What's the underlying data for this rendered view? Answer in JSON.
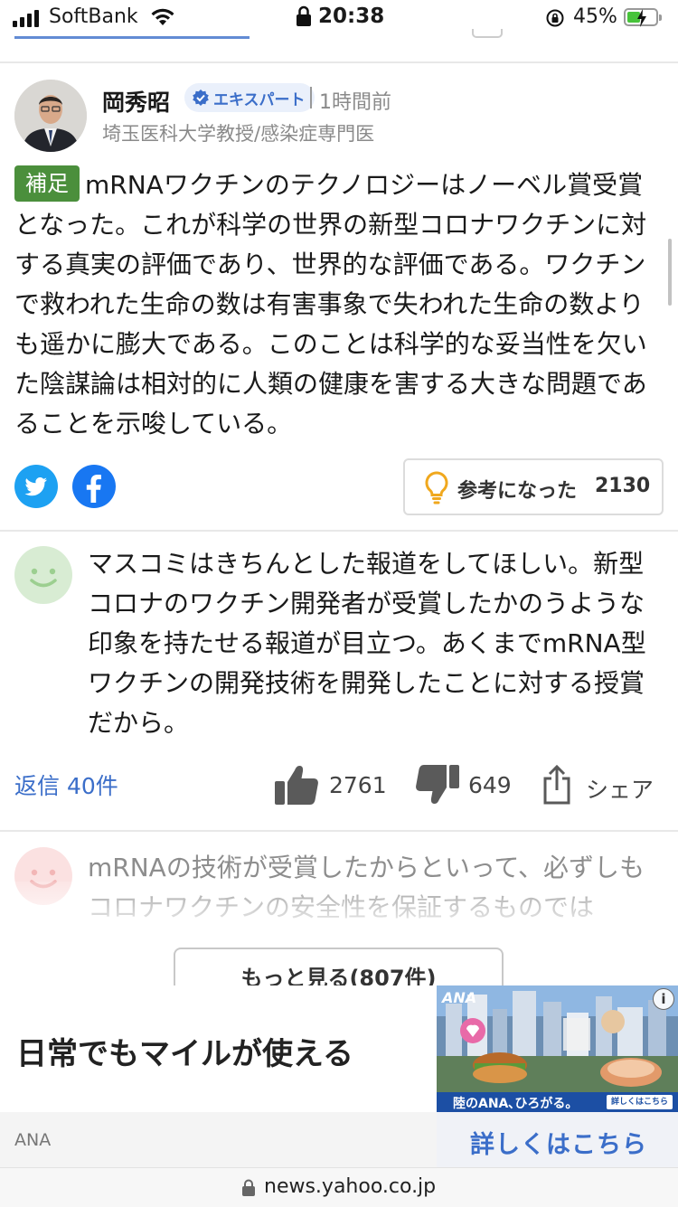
{
  "status_bar": {
    "carrier": "SoftBank",
    "time": "20:38",
    "battery_percent": "45%",
    "battery_level": 0.45
  },
  "expert_comment": {
    "author_name": "岡秀昭",
    "badge": "エキスパート",
    "time": "1時間前",
    "author_title": "埼玉医科大学教授/感染症専門医",
    "tag": "補足",
    "body": "mRNAワクチンのテクノロジーはノーベル賞受賞となった。これが科学の世界の新型コロナワクチンに対する真実の評価であり、世界的な評価である。ワクチンで救われた生命の数は有害事象で失われた生命の数よりも遥かに膨大である。このことは科学的な妥当性を欠いた陰謀論は相対的に人類の健康を害する大きな問題であることを示唆している。",
    "helpful_label": "参考になった",
    "helpful_count": "2130"
  },
  "comments": [
    {
      "body": "マスコミはきちんとした報道をしてほしい。新型コロナのワクチン開発者が受賞したかのうような印象を持たせる報道が目立つ。あくまでmRNA型ワクチンの開発技術を開発したことに対する授賞だから。",
      "reply_label": "返信 40件",
      "likes": "2761",
      "dislikes": "649",
      "share_label": "シェア"
    },
    {
      "body": "mRNAの技術が受賞したからといって、必ずしもコロナワクチンの安全性を保証するものでは"
    }
  ],
  "more_button": "もっと見る(807件)",
  "ad": {
    "headline": "日常でもマイルが使える",
    "image_logo": "ANA",
    "image_caption": "陸のANA､ひろがる。",
    "image_button": "詳しくはこちら",
    "advertiser": "ANA",
    "cta": "詳しくはこちら"
  },
  "url_bar": {
    "url": "news.yahoo.co.jp"
  },
  "colors": {
    "link_blue": "#3b6ec9",
    "tag_green": "#4b8f3c",
    "twitter": "#1da1f2",
    "facebook": "#1877f2"
  }
}
